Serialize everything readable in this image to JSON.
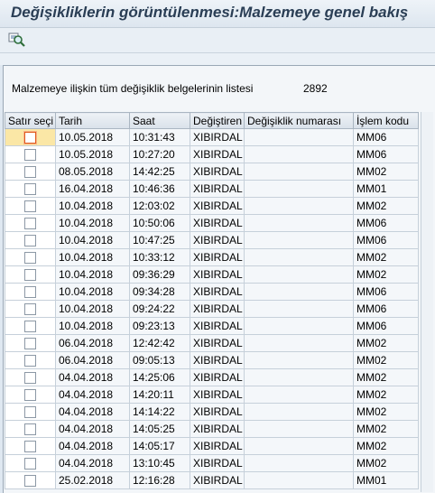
{
  "window": {
    "title": "Değişikliklerin görüntülenmesi:Malzemeye genel bakış"
  },
  "toolbar": {
    "icon": "magnifier-details-icon"
  },
  "info": {
    "label": "Malzemeye ilişkin tüm değişiklik belgelerinin listesi",
    "count": "2892"
  },
  "table": {
    "headers": [
      "Satır seçi",
      "Tarih",
      "Saat",
      "Değiştiren",
      "Değişiklik numarası",
      "İşlem kodu"
    ],
    "rows": [
      {
        "date": "10.05.2018",
        "time": "10:31:43",
        "user": "XIBIRDAL",
        "change_no": "",
        "tcode": "MM06",
        "selected": true
      },
      {
        "date": "10.05.2018",
        "time": "10:27:20",
        "user": "XIBIRDAL",
        "change_no": "",
        "tcode": "MM06",
        "selected": false
      },
      {
        "date": "08.05.2018",
        "time": "14:42:25",
        "user": "XIBIRDAL",
        "change_no": "",
        "tcode": "MM02",
        "selected": false
      },
      {
        "date": "16.04.2018",
        "time": "10:46:36",
        "user": "XIBIRDAL",
        "change_no": "",
        "tcode": "MM01",
        "selected": false
      },
      {
        "date": "10.04.2018",
        "time": "12:03:02",
        "user": "XIBIRDAL",
        "change_no": "",
        "tcode": "MM02",
        "selected": false
      },
      {
        "date": "10.04.2018",
        "time": "10:50:06",
        "user": "XIBIRDAL",
        "change_no": "",
        "tcode": "MM06",
        "selected": false
      },
      {
        "date": "10.04.2018",
        "time": "10:47:25",
        "user": "XIBIRDAL",
        "change_no": "",
        "tcode": "MM06",
        "selected": false
      },
      {
        "date": "10.04.2018",
        "time": "10:33:12",
        "user": "XIBIRDAL",
        "change_no": "",
        "tcode": "MM02",
        "selected": false
      },
      {
        "date": "10.04.2018",
        "time": "09:36:29",
        "user": "XIBIRDAL",
        "change_no": "",
        "tcode": "MM02",
        "selected": false
      },
      {
        "date": "10.04.2018",
        "time": "09:34:28",
        "user": "XIBIRDAL",
        "change_no": "",
        "tcode": "MM06",
        "selected": false
      },
      {
        "date": "10.04.2018",
        "time": "09:24:22",
        "user": "XIBIRDAL",
        "change_no": "",
        "tcode": "MM06",
        "selected": false
      },
      {
        "date": "10.04.2018",
        "time": "09:23:13",
        "user": "XIBIRDAL",
        "change_no": "",
        "tcode": "MM06",
        "selected": false
      },
      {
        "date": "06.04.2018",
        "time": "12:42:42",
        "user": "XIBIRDAL",
        "change_no": "",
        "tcode": "MM02",
        "selected": false
      },
      {
        "date": "06.04.2018",
        "time": "09:05:13",
        "user": "XIBIRDAL",
        "change_no": "",
        "tcode": "MM02",
        "selected": false
      },
      {
        "date": "04.04.2018",
        "time": "14:25:06",
        "user": "XIBIRDAL",
        "change_no": "",
        "tcode": "MM02",
        "selected": false
      },
      {
        "date": "04.04.2018",
        "time": "14:20:11",
        "user": "XIBIRDAL",
        "change_no": "",
        "tcode": "MM02",
        "selected": false
      },
      {
        "date": "04.04.2018",
        "time": "14:14:22",
        "user": "XIBIRDAL",
        "change_no": "",
        "tcode": "MM02",
        "selected": false
      },
      {
        "date": "04.04.2018",
        "time": "14:05:25",
        "user": "XIBIRDAL",
        "change_no": "",
        "tcode": "MM02",
        "selected": false
      },
      {
        "date": "04.04.2018",
        "time": "14:05:17",
        "user": "XIBIRDAL",
        "change_no": "",
        "tcode": "MM02",
        "selected": false
      },
      {
        "date": "04.04.2018",
        "time": "13:10:45",
        "user": "XIBIRDAL",
        "change_no": "",
        "tcode": "MM02",
        "selected": false
      },
      {
        "date": "25.02.2018",
        "time": "12:16:28",
        "user": "XIBIRDAL",
        "change_no": "",
        "tcode": "MM01",
        "selected": false
      }
    ]
  }
}
